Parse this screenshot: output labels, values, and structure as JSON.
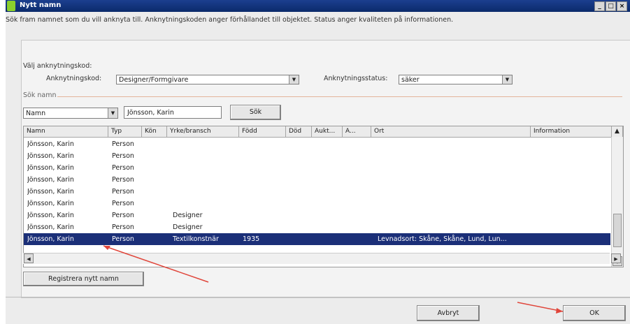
{
  "window": {
    "title": "Nytt namn",
    "description": "Sök fram namnet som du vill anknyta till. Anknytningskoden anger förhållandet till objektet. Status anger kvaliteten på informationen."
  },
  "association": {
    "section_label": "Välj anknytningskod:",
    "code_label": "Anknytningskod:",
    "code_value": "Designer/Formgivare",
    "status_label": "Anknytningsstatus:",
    "status_value": "säker"
  },
  "search": {
    "section_label": "Sök namn",
    "field_value": "Namn",
    "query_value": "Jönsson, Karin",
    "search_button": "Sök"
  },
  "table": {
    "columns": [
      "Namn",
      "Typ",
      "Kön",
      "Yrke/bransch",
      "Född",
      "Död",
      "Aukt...",
      "A...",
      "Ort",
      "Information"
    ],
    "rows": [
      [
        "Jönsson, Karin",
        "Person",
        "",
        "",
        "",
        "",
        "",
        "",
        "",
        ""
      ],
      [
        "Jönsson, Karin",
        "Person",
        "",
        "",
        "",
        "",
        "",
        "",
        "",
        ""
      ],
      [
        "Jönsson, Karin",
        "Person",
        "",
        "",
        "",
        "",
        "",
        "",
        "",
        ""
      ],
      [
        "Jönsson, Karin",
        "Person",
        "",
        "",
        "",
        "",
        "",
        "",
        "",
        ""
      ],
      [
        "Jönsson, Karin",
        "Person",
        "",
        "",
        "",
        "",
        "",
        "",
        "",
        ""
      ],
      [
        "Jönsson, Karin",
        "Person",
        "",
        "",
        "",
        "",
        "",
        "",
        "",
        ""
      ],
      [
        "Jönsson, Karin",
        "Person",
        "",
        "Designer",
        "",
        "",
        "",
        "",
        "",
        ""
      ],
      [
        "Jönsson, Karin",
        "Person",
        "",
        "Designer",
        "",
        "",
        "",
        "",
        "",
        ""
      ],
      [
        "Jönsson, Karin",
        "Person",
        "",
        "Textilkonstnär",
        "1935",
        "",
        "",
        "",
        "Levnadsort: Skåne, Skåne, Lund, Lun...",
        ""
      ]
    ],
    "selected_row": 8
  },
  "buttons": {
    "register_new": "Registrera nytt namn",
    "cancel": "Avbryt",
    "ok": "OK"
  },
  "colors": {
    "selection": "#1b2f78",
    "annotation_arrow": "#e0453a",
    "titlebar": "#0b2a6b"
  }
}
